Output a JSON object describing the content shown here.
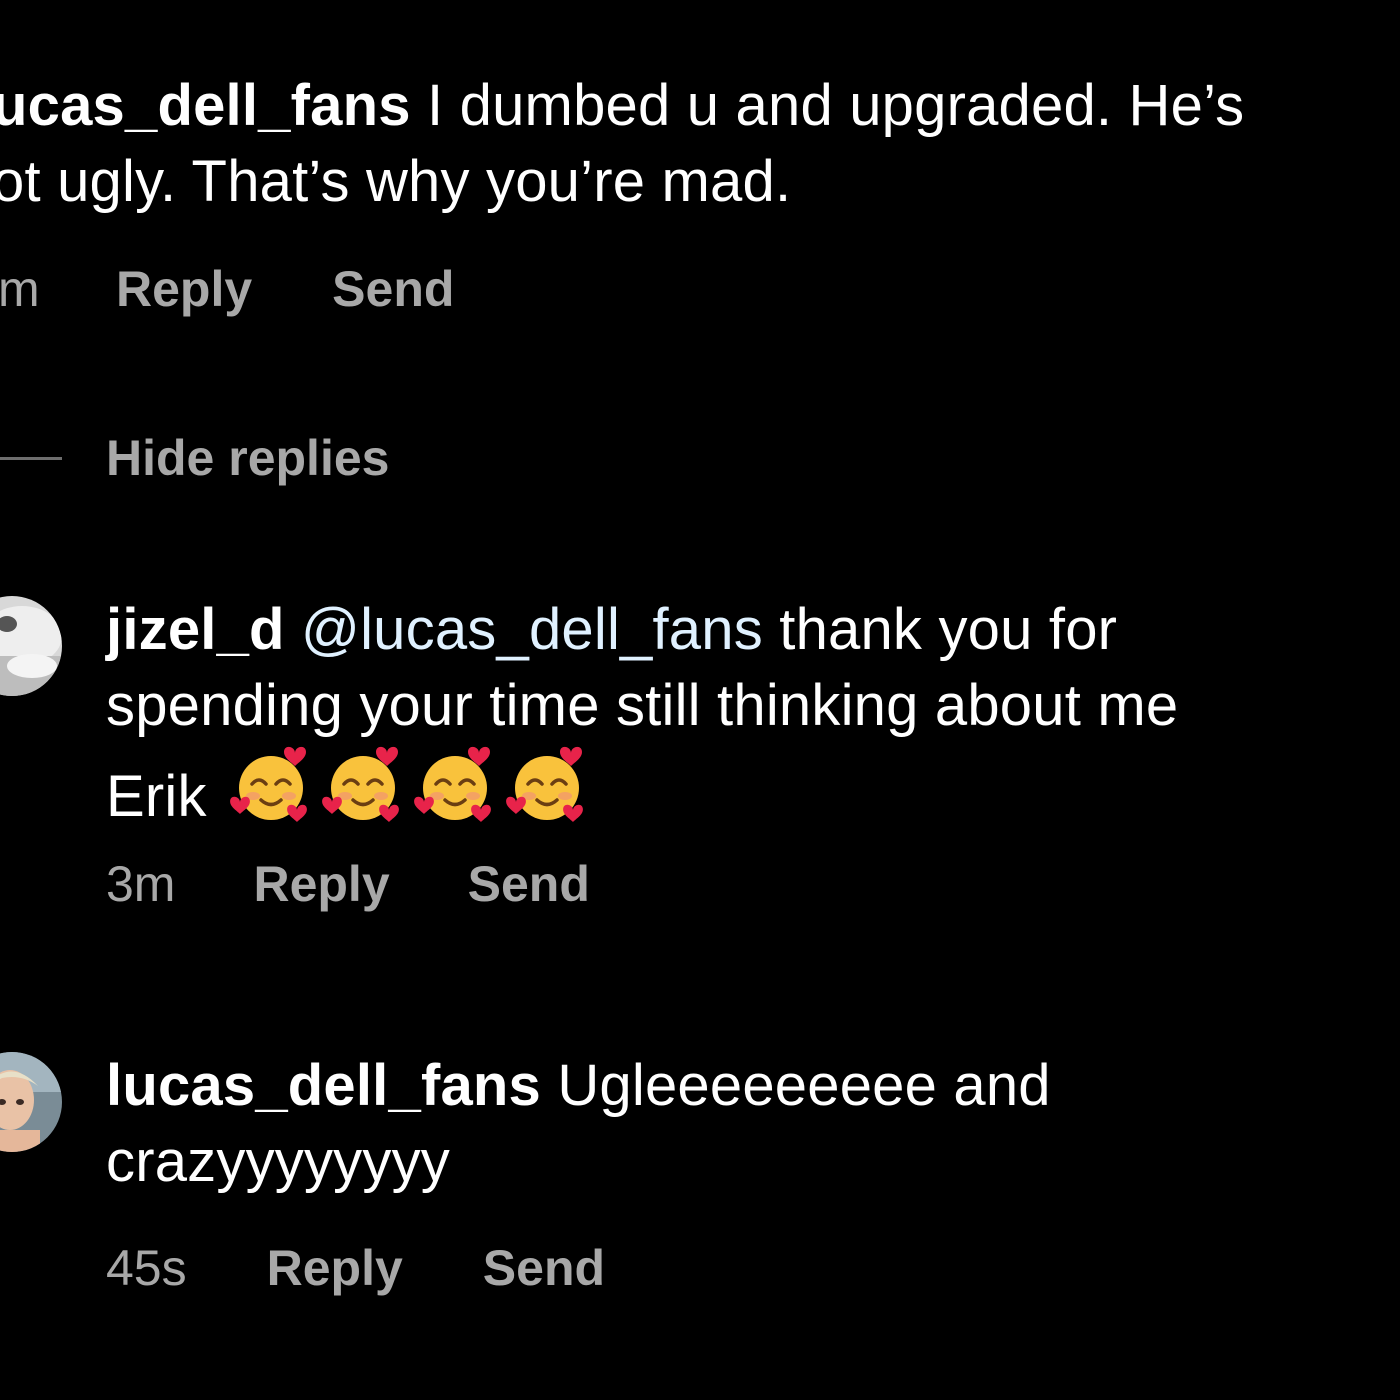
{
  "comments": [
    {
      "username": "ucas_dell_fans",
      "line1": "I dumbed u and upgraded. He’s",
      "line2": "ot ugly. That’s why you’re mad.",
      "time": "m",
      "reply_label": "Reply",
      "send_label": "Send"
    },
    {
      "username": "jizel_d",
      "mention": "@lucas_dell_fans",
      "line1": "thank you for",
      "line2": "spending your time still thinking about me",
      "line3": "Erik",
      "emoji_name": "smiling-face-with-hearts-icon",
      "emoji_count": 4,
      "time": "3m",
      "reply_label": "Reply",
      "send_label": "Send"
    },
    {
      "username": "lucas_dell_fans",
      "line1": "Ugleeeeeeeee and",
      "line2": "crazyyyyyyyy",
      "time": "45s",
      "reply_label": "Reply",
      "send_label": "Send"
    }
  ],
  "hide_replies_label": "Hide replies",
  "colors": {
    "background": "#000000",
    "text": "#ffffff",
    "secondary": "#a8a8a8",
    "mention": "#e0f1ff"
  }
}
